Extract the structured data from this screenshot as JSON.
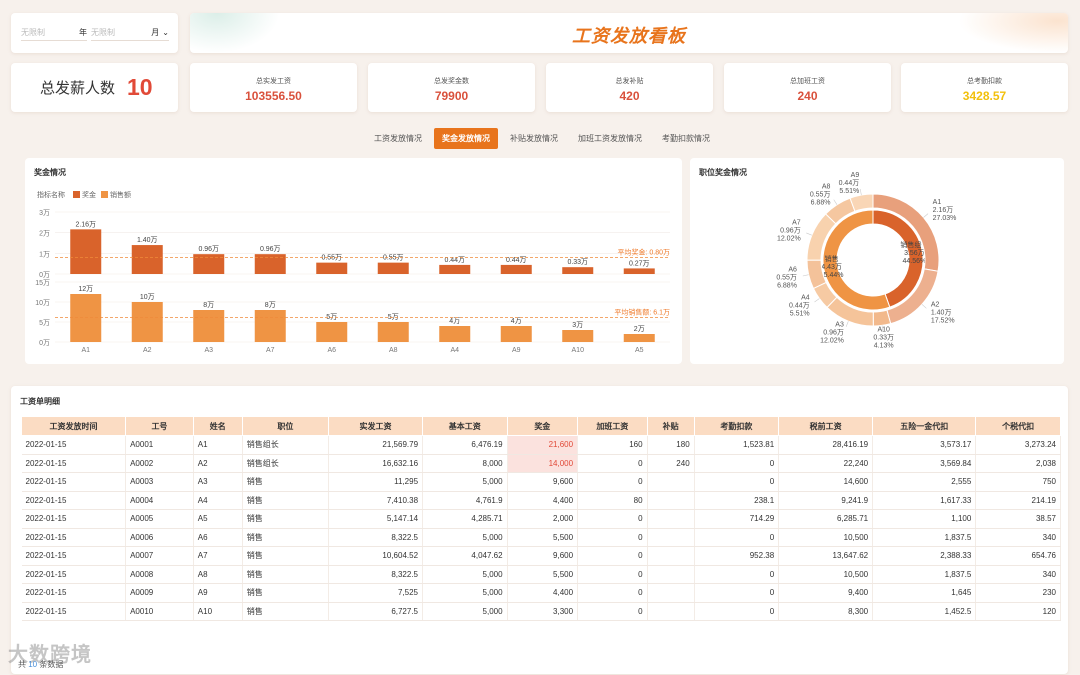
{
  "filter": {
    "year_placeholder": "无限制",
    "year_label": "年",
    "month_placeholder": "无限制",
    "month_label": "月"
  },
  "title": "工资发放看板",
  "kpi_head": {
    "label": "总发薪人数",
    "value": "10"
  },
  "kpis": [
    {
      "label": "总实发工资",
      "value": "103556.50",
      "color": "#d9513c"
    },
    {
      "label": "总发奖金数",
      "value": "79900",
      "color": "#d9513c"
    },
    {
      "label": "总发补贴",
      "value": "420",
      "color": "#d9513c"
    },
    {
      "label": "总加班工资",
      "value": "240",
      "color": "#d9513c"
    },
    {
      "label": "总考勤扣款",
      "value": "3428.57",
      "color": "#f2c00c"
    }
  ],
  "tabs": [
    "工资发放情况",
    "奖金发放情况",
    "补贴发放情况",
    "加班工资发放情况",
    "考勤扣款情况"
  ],
  "active_tab": 1,
  "bonus_panel": {
    "title": "奖金情况",
    "legend_title": "指标名称",
    "legend": [
      "奖金",
      "销售额"
    ]
  },
  "pos_panel": {
    "title": "职位奖金情况"
  },
  "chart_data": [
    {
      "type": "bar",
      "title": "奖金情况",
      "categories": [
        "A1",
        "A2",
        "A3",
        "A7",
        "A6",
        "A8",
        "A4",
        "A9",
        "A10",
        "A5"
      ],
      "series": [
        {
          "name": "奖金",
          "values": [
            2.16,
            1.4,
            0.96,
            0.96,
            0.55,
            0.55,
            0.44,
            0.44,
            0.33,
            0.27
          ],
          "labels": [
            "2.16万",
            "1.40万",
            "0.96万",
            "0.96万",
            "0.55万",
            "0.55万",
            "0.44万",
            "0.44万",
            "0.33万",
            "0.27万"
          ],
          "color": "#d9632b",
          "ylim": [
            0,
            3
          ],
          "yticks": [
            "3万",
            "2万",
            "1万",
            "0万"
          ],
          "avg": 0.8,
          "avg_label": "平均奖金: 0.80万"
        },
        {
          "name": "销售额",
          "values": [
            12,
            10,
            8,
            8,
            5,
            5,
            4,
            4,
            3,
            2
          ],
          "labels": [
            "12万",
            "10万",
            "8万",
            "8万",
            "5万",
            "5万",
            "4万",
            "4万",
            "3万",
            "2万"
          ],
          "color": "#ef9444",
          "ylim": [
            0,
            15
          ],
          "yticks": [
            "15万",
            "10万",
            "5万",
            "0万"
          ],
          "avg": 6.1,
          "avg_label": "平均销售额: 6.1万"
        }
      ]
    },
    {
      "type": "pie",
      "title": "职位奖金情况",
      "inner": [
        {
          "label": "销售组长",
          "value_label": "3.56万",
          "pct": "44.56%",
          "value": 44.56,
          "color": "#d9632b"
        },
        {
          "label": "销售",
          "value_label": "4.43万",
          "pct": "55.44%",
          "value": 55.44,
          "color": "#ef9444"
        }
      ],
      "outer": [
        {
          "label": "A1",
          "value_label": "2.16万",
          "pct": "27.03%",
          "value": 27.03,
          "color": "#e8a07c"
        },
        {
          "label": "A2",
          "value_label": "1.40万",
          "pct": "17.52%",
          "value": 17.52,
          "color": "#edb08f"
        },
        {
          "label": "A10",
          "value_label": "0.33万",
          "pct": "4.13%",
          "value": 4.13,
          "color": "#f2b98c"
        },
        {
          "label": "A3",
          "value_label": "0.96万",
          "pct": "12.02%",
          "value": 12.02,
          "color": "#f5c49a"
        },
        {
          "label": "A4",
          "value_label": "0.44万",
          "pct": "5.51%",
          "value": 5.51,
          "color": "#f6caa3"
        },
        {
          "label": "A6",
          "value_label": "0.55万",
          "pct": "6.88%",
          "value": 6.88,
          "color": "#f4c29a"
        },
        {
          "label": "A7",
          "value_label": "0.96万",
          "pct": "12.02%",
          "value": 12.02,
          "color": "#f8d2ae"
        },
        {
          "label": "A8",
          "value_label": "0.55万",
          "pct": "6.88%",
          "value": 6.88,
          "color": "#f5c7a0"
        },
        {
          "label": "A9",
          "value_label": "0.44万",
          "pct": "5.51%",
          "value": 5.51,
          "color": "#f9d6b6"
        }
      ]
    }
  ],
  "table": {
    "title": "工资单明细",
    "headers": [
      "工资发放时间",
      "工号",
      "姓名",
      "职位",
      "实发工资",
      "基本工资",
      "奖金",
      "加班工资",
      "补贴",
      "考勤扣款",
      "税前工资",
      "五险一金代扣",
      "个税代扣"
    ],
    "rows": [
      [
        "2022-01-15",
        "A0001",
        "A1",
        "销售组长",
        "21,569.79",
        "6,476.19",
        "21,600",
        "160",
        "180",
        "1,523.81",
        "28,416.19",
        "3,573.17",
        "3,273.24"
      ],
      [
        "2022-01-15",
        "A0002",
        "A2",
        "销售组长",
        "16,632.16",
        "8,000",
        "14,000",
        "0",
        "240",
        "0",
        "22,240",
        "3,569.84",
        "2,038"
      ],
      [
        "2022-01-15",
        "A0003",
        "A3",
        "销售",
        "11,295",
        "5,000",
        "9,600",
        "0",
        "",
        "0",
        "14,600",
        "2,555",
        "750"
      ],
      [
        "2022-01-15",
        "A0004",
        "A4",
        "销售",
        "7,410.38",
        "4,761.9",
        "4,400",
        "80",
        "",
        "238.1",
        "9,241.9",
        "1,617.33",
        "214.19"
      ],
      [
        "2022-01-15",
        "A0005",
        "A5",
        "销售",
        "5,147.14",
        "4,285.71",
        "2,000",
        "0",
        "",
        "714.29",
        "6,285.71",
        "1,100",
        "38.57"
      ],
      [
        "2022-01-15",
        "A0006",
        "A6",
        "销售",
        "8,322.5",
        "5,000",
        "5,500",
        "0",
        "",
        "0",
        "10,500",
        "1,837.5",
        "340"
      ],
      [
        "2022-01-15",
        "A0007",
        "A7",
        "销售",
        "10,604.52",
        "4,047.62",
        "9,600",
        "0",
        "",
        "952.38",
        "13,647.62",
        "2,388.33",
        "654.76"
      ],
      [
        "2022-01-15",
        "A0008",
        "A8",
        "销售",
        "8,322.5",
        "5,000",
        "5,500",
        "0",
        "",
        "0",
        "10,500",
        "1,837.5",
        "340"
      ],
      [
        "2022-01-15",
        "A0009",
        "A9",
        "销售",
        "7,525",
        "5,000",
        "4,400",
        "0",
        "",
        "0",
        "9,400",
        "1,645",
        "230"
      ],
      [
        "2022-01-15",
        "A0010",
        "A10",
        "销售",
        "6,727.5",
        "5,000",
        "3,300",
        "0",
        "",
        "0",
        "8,300",
        "1,452.5",
        "120"
      ]
    ]
  },
  "footer": {
    "prefix": "共",
    "count": "10",
    "suffix": "条数据"
  },
  "watermark": "大数跨境"
}
